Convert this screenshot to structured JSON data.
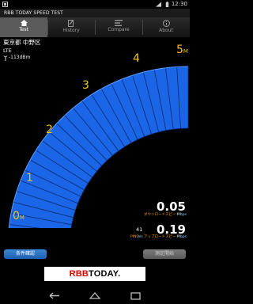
{
  "status": {
    "time": "12:30"
  },
  "app": {
    "title": "RBB TODAY SPEED TEST"
  },
  "tabs": [
    {
      "label": "Test",
      "icon": "home-icon",
      "active": true
    },
    {
      "label": "History",
      "icon": "history-icon",
      "active": false
    },
    {
      "label": "Compare",
      "icon": "compare-icon",
      "active": false
    },
    {
      "label": "About",
      "icon": "info-icon",
      "active": false
    }
  ],
  "location": {
    "place": "東京都 中野区",
    "network": "LTE",
    "signal": "-113dBm"
  },
  "gauge": {
    "scale": [
      "0",
      "1",
      "2",
      "3",
      "4",
      "5"
    ],
    "unit_sub": "M",
    "max_label_unit": "M",
    "fill_fraction": 1.0,
    "colors": {
      "fill": "#1a66e6",
      "label": "#f0c419"
    }
  },
  "results": {
    "download": {
      "value": "0.05",
      "label": "ダウンロードスピード",
      "unit": "Mbps"
    },
    "upload": {
      "value": "0.19",
      "label": "アップロードスピード",
      "unit": "Mbps"
    },
    "ping": {
      "value": "41",
      "label": "PING",
      "unit": "ms"
    }
  },
  "buttons": {
    "conditions": "条件確認",
    "start": "測定開始"
  },
  "ad": {
    "logo_red": "RBB",
    "logo_black": "TODAY."
  },
  "nav": {
    "back": "back-icon",
    "home": "home-nav-icon",
    "recents": "recents-icon"
  }
}
